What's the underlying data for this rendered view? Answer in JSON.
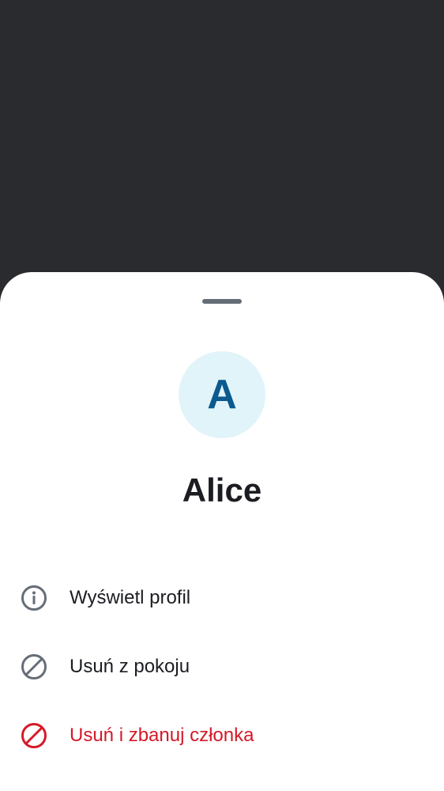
{
  "user": {
    "avatar_initial": "A",
    "name": "Alice"
  },
  "menu": {
    "items": [
      {
        "label": "Wyświetl profil",
        "icon": "info-icon"
      },
      {
        "label": "Usuń z pokoju",
        "icon": "block-icon"
      },
      {
        "label": "Usuń i zbanuj członka",
        "icon": "ban-icon",
        "danger": true
      }
    ]
  },
  "colors": {
    "backdrop": "#2a2b2e",
    "sheet": "#ffffff",
    "avatar_bg": "#e1f4f9",
    "avatar_text": "#0b5a8e",
    "text_primary": "#1b1d22",
    "icon_gray": "#656d77",
    "danger": "#d51928"
  }
}
